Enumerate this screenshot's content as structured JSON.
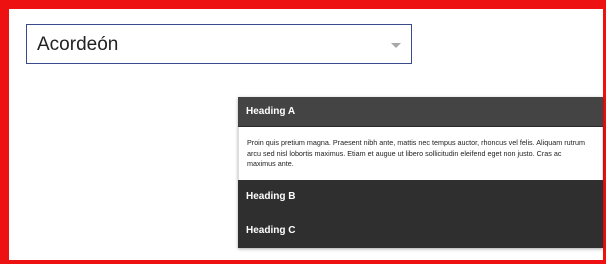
{
  "select": {
    "value": "Acordeón",
    "caret_icon": "chevron-down-icon"
  },
  "accordion": {
    "panels": [
      {
        "heading": "Heading A",
        "body": "Proin quis pretium magna. Praesent nibh ante, mattis nec tempus auctor, rhoncus vel felis. Aliquam rutrum arcu sed nisl lobortis maximus. Etiam et augue ut libero sollicitudin eleifend eget non justo. Cras ac maximus ante."
      },
      {
        "heading": "Heading B"
      },
      {
        "heading": "Heading C"
      }
    ]
  },
  "colors": {
    "frame_border": "#ee1111",
    "header_bg": "#3a3a3a",
    "select_border": "#3a4b8c"
  }
}
